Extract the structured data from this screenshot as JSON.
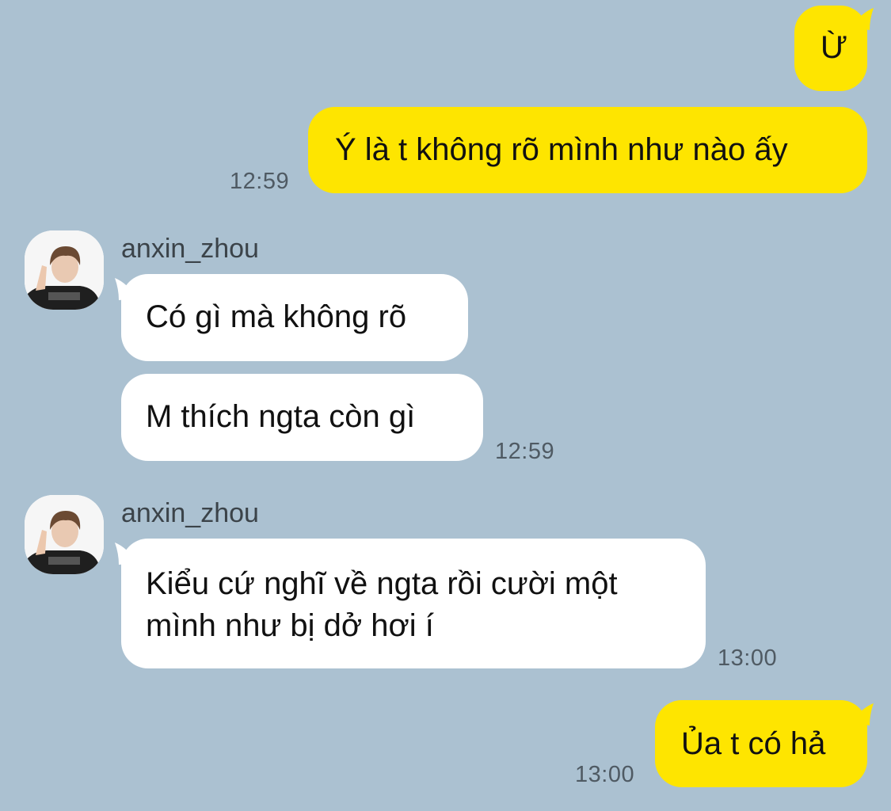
{
  "chat": {
    "contact_name": "anxin_zhou",
    "messages": [
      {
        "sender": "me",
        "text": "Ừ"
      },
      {
        "sender": "me",
        "text": "Ý là t không rõ mình như nào ấy",
        "time": "12:59"
      },
      {
        "sender": "anxin_zhou",
        "text": "Có gì mà không rõ"
      },
      {
        "sender": "anxin_zhou",
        "text": "M thích ngta còn gì",
        "time": "12:59"
      },
      {
        "sender": "anxin_zhou",
        "text_line1": "Kiểu cứ nghĩ về ngta rồi cười một",
        "text_line2": "mình như bị dở hơi í",
        "time": "13:00"
      },
      {
        "sender": "me",
        "text": "Ủa t có hả",
        "time": "13:00"
      }
    ]
  },
  "colors": {
    "background": "#abc1d1",
    "my_bubble": "#fee500",
    "their_bubble": "#ffffff"
  },
  "icons": {
    "avatar": "profile-photo"
  }
}
